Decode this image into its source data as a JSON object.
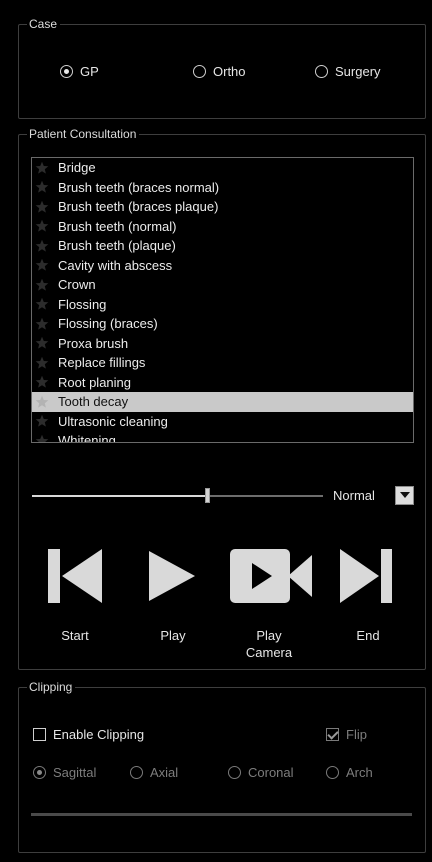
{
  "case": {
    "title": "Case",
    "options": [
      {
        "label": "GP",
        "checked": true
      },
      {
        "label": "Ortho",
        "checked": false
      },
      {
        "label": "Surgery",
        "checked": false
      }
    ]
  },
  "consultation": {
    "title": "Patient Consultation",
    "items": [
      "Bridge",
      "Brush teeth (braces normal)",
      "Brush teeth (braces plaque)",
      "Brush teeth (normal)",
      "Brush teeth (plaque)",
      "Cavity with abscess",
      "Crown",
      "Flossing",
      "Flossing (braces)",
      "Proxa brush",
      "Replace fillings",
      "Root planing",
      "Tooth decay",
      "Ultrasonic cleaning",
      "Whitening"
    ],
    "selected_index": 12,
    "progress_fraction": 0.6,
    "speed": "Normal",
    "controls": {
      "start": "Start",
      "play": "Play",
      "play_camera": "Play\nCamera",
      "end": "End"
    }
  },
  "clipping": {
    "title": "Clipping",
    "enable_label": "Enable Clipping",
    "enable_checked": false,
    "flip_label": "Flip",
    "flip_checked": true,
    "planes": [
      {
        "label": "Sagittal",
        "checked": true
      },
      {
        "label": "Axial",
        "checked": false
      },
      {
        "label": "Coronal",
        "checked": false
      },
      {
        "label": "Arch",
        "checked": false
      }
    ]
  }
}
